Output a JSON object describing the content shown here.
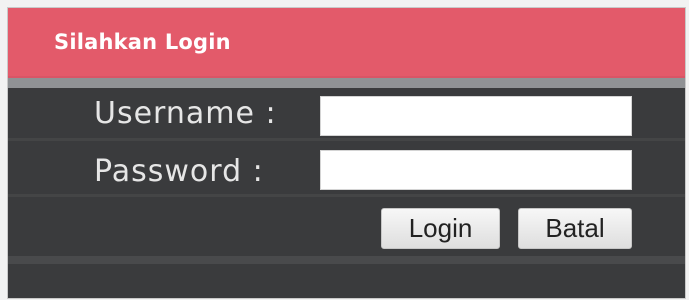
{
  "header": {
    "title": "Silahkan Login"
  },
  "form": {
    "username_label": "Username :",
    "password_label": "Password  :",
    "username_value": "",
    "password_value": ""
  },
  "buttons": {
    "login_label": "Login",
    "cancel_label": "Batal"
  },
  "colors": {
    "header_bg": "#e35a6a",
    "panel_bg": "#3a3b3d",
    "label_text": "#e6e6e6"
  }
}
